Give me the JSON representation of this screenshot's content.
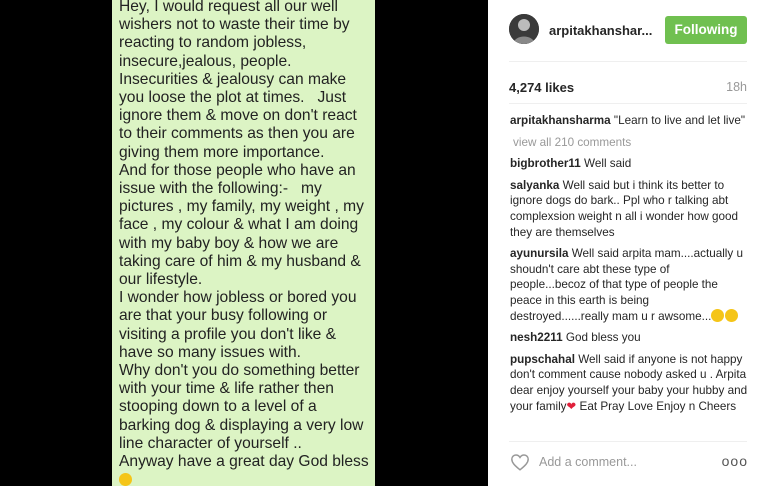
{
  "note": {
    "paragraphs": [
      "Hey, I would request all our well wishers not to waste their time by reacting to random jobless, insecure,jealous, people. Insecurities & jealousy can make you loose the plot at times.   Just ignore them & move on don't react to their comments as then you are giving them more importance.",
      "And for those people who have an issue with the following:-   my pictures , my family, my weight , my face , my colour & what I am doing with my baby boy & how we are taking care of him & my husband & our lifestyle.",
      "I wonder how jobless or bored you are that your busy following or visiting a profile you don't like & have so many issues with.",
      "Why don't you do something better with your time & life rather then stooping down to a level of a barking dog & displaying a very low line character of yourself ..",
      "Anyway have a great day God bless"
    ]
  },
  "header": {
    "username": "arpitakhanshar...",
    "follow_label": "Following"
  },
  "stats": {
    "likes": "4,274 likes",
    "time": "18h"
  },
  "comments": {
    "caption": {
      "user": "arpitakhansharma",
      "text": " \"Learn to live and let live\""
    },
    "view_all": "view all 210 comments",
    "items": [
      {
        "user": "bigbrother11",
        "text": " Well said"
      },
      {
        "user": "salyanka",
        "text": " Well said but i think its better to ignore dogs do bark.. Ppl who r talking abt complexsion weight n all i wonder how good they are themselves"
      },
      {
        "user": "ayunursila",
        "text": " Well said arpita mam....actually u shoudn't care abt these type of people...becoz of that type of people the peace in this earth is being destroyed......really mam u r awsome..."
      },
      {
        "user": "nesh2211",
        "text": " God bless you"
      },
      {
        "user": "pupschahal",
        "text": " Well said if anyone is not happy don't comment cause nobody asked u . Arpita dear enjoy yourself your baby your hubby and your family",
        "text2": " Eat Pray Love Enjoy n Cheers"
      }
    ]
  },
  "footer": {
    "comment_placeholder": "Add a comment...",
    "more_label": "ooo"
  },
  "colors": {
    "follow_button": "#70c050",
    "note_background": "#dcf4c4"
  },
  "icons": {
    "like": "heart-outline-icon",
    "avatar": "profile-avatar",
    "emoji": "smiling-face-emoji"
  }
}
